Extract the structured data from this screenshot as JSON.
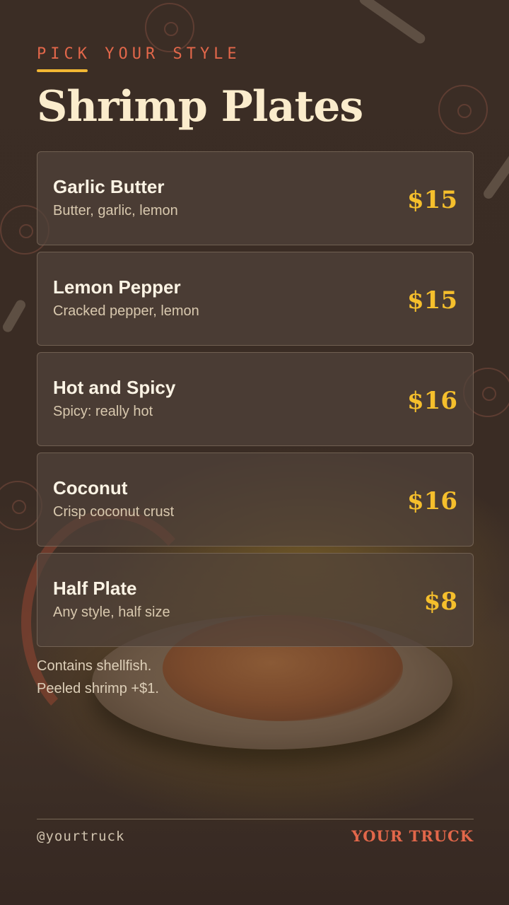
{
  "header": {
    "kicker": "PICK YOUR STYLE",
    "title": "Shrimp Plates"
  },
  "menu": {
    "items": [
      {
        "name": "Garlic Butter",
        "description": "Butter, garlic, lemon",
        "price": "$15"
      },
      {
        "name": "Lemon Pepper",
        "description": "Cracked pepper, lemon",
        "price": "$15"
      },
      {
        "name": "Hot and Spicy",
        "description": "Spicy: really hot",
        "price": "$16"
      },
      {
        "name": "Coconut",
        "description": "Crisp coconut crust",
        "price": "$16"
      },
      {
        "name": "Half Plate",
        "description": "Any style, half size",
        "price": "$8"
      }
    ]
  },
  "notes": {
    "line1": "Contains shellfish.",
    "line2": "Peeled shrimp +$1."
  },
  "footer": {
    "handle": "@yourtruck",
    "brand": "YOUR TRUCK"
  },
  "colors": {
    "background": "#3a2c24",
    "accent_red": "#e2674a",
    "accent_yellow": "#f5bf2c",
    "title_cream": "#fbeccc"
  }
}
